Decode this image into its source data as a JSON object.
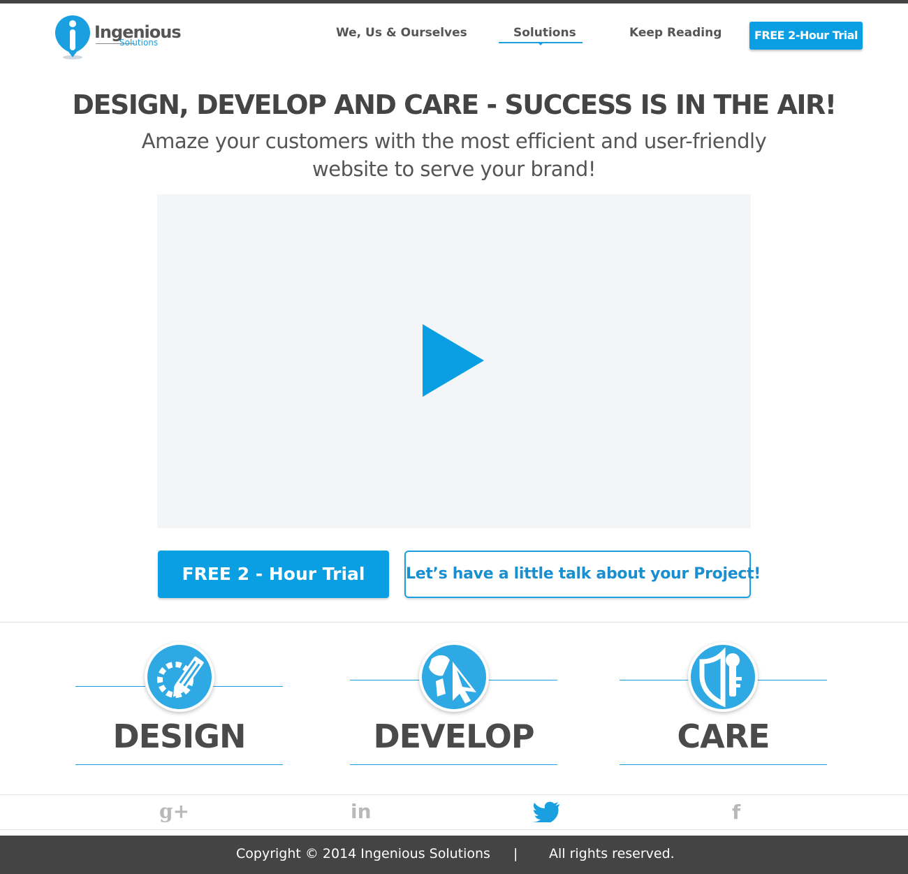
{
  "brand": {
    "name": "Ingenious",
    "sub": "Solutions",
    "accent": "#0a9fe3",
    "dark": "#444444"
  },
  "nav": {
    "items": [
      {
        "label": "We, Us & Ourselves"
      },
      {
        "label": "Solutions",
        "active": true
      },
      {
        "label": "Keep Reading"
      }
    ],
    "cta": "FREE 2-Hour Trial"
  },
  "hero": {
    "title": "DESIGN, DEVELOP AND CARE - SUCCESS IS IN THE AIR!",
    "subtitle_line1": "Amaze your customers with the most efficient and user-friendly",
    "subtitle_line2": "website to serve your brand!",
    "video_icon": "play-icon"
  },
  "cta": {
    "primary": "FREE 2 - Hour Trial",
    "secondary": "Let’s have a little talk about your Project!"
  },
  "features": [
    {
      "label": "DESIGN",
      "icon": "design-gear-pencil-icon"
    },
    {
      "label": "DEVELOP",
      "icon": "develop-cursor-icon"
    },
    {
      "label": "CARE",
      "icon": "care-shield-icon"
    }
  ],
  "social": [
    {
      "icon": "google-plus-icon",
      "glyph": "g+"
    },
    {
      "icon": "linkedin-icon",
      "glyph": "in"
    },
    {
      "icon": "twitter-icon"
    },
    {
      "icon": "facebook-icon",
      "glyph": "f"
    }
  ],
  "footer": {
    "copyright": "Copyright © 2014 Ingenious Solutions",
    "separator": "|",
    "rights": "All rights reserved."
  }
}
